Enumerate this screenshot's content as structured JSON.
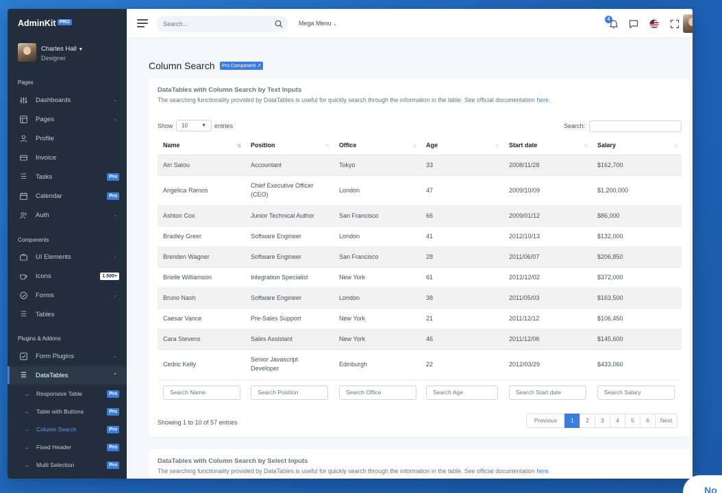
{
  "brand": {
    "name": "AdminKit",
    "badge": "PRO"
  },
  "user": {
    "name": "Charles Hall",
    "role": "Designer"
  },
  "sidebar": {
    "sections": [
      "Pages",
      "Components",
      "Plugins & Addons"
    ],
    "pages": [
      {
        "label": "Dashboards",
        "icon": "sliders-icon",
        "chevron": true
      },
      {
        "label": "Pages",
        "icon": "layout-icon",
        "chevron": true
      },
      {
        "label": "Profile",
        "icon": "user-icon"
      },
      {
        "label": "Invoice",
        "icon": "credit-card-icon"
      },
      {
        "label": "Tasks",
        "icon": "list-icon",
        "badge": "Pro"
      },
      {
        "label": "Calendar",
        "icon": "calendar-icon",
        "badge": "Pro"
      },
      {
        "label": "Auth",
        "icon": "users-icon",
        "chevron": true
      }
    ],
    "components": [
      {
        "label": "UI Elements",
        "icon": "briefcase-icon",
        "chevron": true
      },
      {
        "label": "Icons",
        "icon": "coffee-icon",
        "badge": "1.500+"
      },
      {
        "label": "Forms",
        "icon": "check-circle-icon",
        "chevron": true
      },
      {
        "label": "Tables",
        "icon": "list-icon"
      }
    ],
    "plugins": [
      {
        "label": "Form Plugins",
        "icon": "check-square-icon",
        "chevron": true
      },
      {
        "label": "DataTables",
        "icon": "list-icon",
        "chevron": true
      }
    ],
    "datatables_sub": [
      {
        "label": "Responsive Table",
        "badge": "Pro"
      },
      {
        "label": "Table with Buttons",
        "badge": "Pro"
      },
      {
        "label": "Column Search",
        "badge": "Pro"
      },
      {
        "label": "Fixed Header",
        "badge": "Pro"
      },
      {
        "label": "Multi Selection",
        "badge": "Pro"
      }
    ]
  },
  "topbar": {
    "search_placeholder": "Search…",
    "mega_menu": "Mega Menu",
    "notification_count": "4"
  },
  "page": {
    "title": "Column Search",
    "pro_badge": "Pro Component"
  },
  "card": {
    "title": "DataTables with Column Search by Text Inputs",
    "subtitle": "The searching functionality provided by DataTables is useful for quickly search through the information in the table. See official documentation ",
    "link": "here",
    "show_label": "Show",
    "page_length": "10",
    "entries_label": "entries",
    "search_label": "Search:",
    "columns": [
      "Name",
      "Position",
      "Office",
      "Age",
      "Start date",
      "Salary"
    ],
    "rows": [
      [
        "Airi Satou",
        "Accountant",
        "Tokyo",
        "33",
        "2008/11/28",
        "$162,700"
      ],
      [
        "Angelica Ramos",
        "Chief Executive Officer (CEO)",
        "London",
        "47",
        "2009/10/09",
        "$1,200,000"
      ],
      [
        "Ashton Cox",
        "Junior Technical Author",
        "San Francisco",
        "66",
        "2009/01/12",
        "$86,000"
      ],
      [
        "Bradley Greer",
        "Software Engineer",
        "London",
        "41",
        "2012/10/13",
        "$132,000"
      ],
      [
        "Brenden Wagner",
        "Software Engineer",
        "San Francisco",
        "28",
        "2011/06/07",
        "$206,850"
      ],
      [
        "Brielle Williamson",
        "Integration Specialist",
        "New York",
        "61",
        "2012/12/02",
        "$372,000"
      ],
      [
        "Bruno Nash",
        "Software Engineer",
        "London",
        "38",
        "2011/05/03",
        "$163,500"
      ],
      [
        "Caesar Vance",
        "Pre-Sales Support",
        "New York",
        "21",
        "2011/12/12",
        "$106,450"
      ],
      [
        "Cara Stevens",
        "Sales Assistant",
        "New York",
        "46",
        "2011/12/06",
        "$145,600"
      ],
      [
        "Cedric Kelly",
        "Senior Javascript Developer",
        "Edinburgh",
        "22",
        "2012/03/29",
        "$433,060"
      ]
    ],
    "column_search_placeholders": [
      "Search Name",
      "Search Position",
      "Search Office",
      "Search Age",
      "Search Start date",
      "Search Salary"
    ],
    "info": "Showing 1 to 10 of 57 entries",
    "pagination": [
      "Previous",
      "1",
      "2",
      "3",
      "4",
      "5",
      "6",
      "Next"
    ],
    "active_page": "1"
  },
  "card2": {
    "title": "DataTables with Column Search by Select Inputs",
    "subtitle": "The searching functionality provided by DataTables is useful for quickly search through the information in the table. See official documentation ",
    "link": "here"
  },
  "corner_button": "No",
  "colors": {
    "accent": "#3b7ddd",
    "sidebar": "#222e3c"
  }
}
